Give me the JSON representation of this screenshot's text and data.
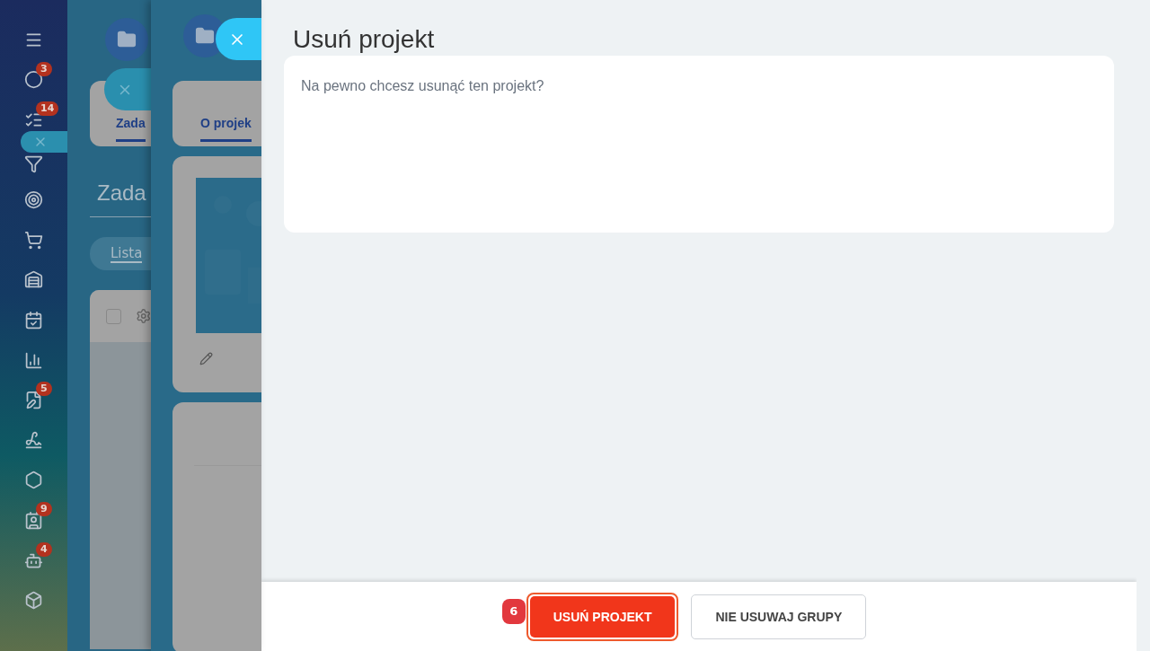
{
  "sidebar": {
    "badges": [
      "3",
      "14",
      "5",
      "9",
      "4"
    ]
  },
  "back_panel": {
    "tab": "Zada",
    "heading": "Zada",
    "view_tab": "Lista",
    "select_all_checked": false
  },
  "middle_panel": {
    "tab": "O projek"
  },
  "dialog": {
    "title": "Usuń projekt",
    "message": "Na pewno chcesz usunąć ten projekt?",
    "step_marker": "6",
    "buttons": [
      {
        "label": "USUŃ PROJEKT",
        "kind": "primary"
      },
      {
        "label": "NIE USUWAJ GRUPY",
        "kind": "secondary"
      }
    ]
  }
}
